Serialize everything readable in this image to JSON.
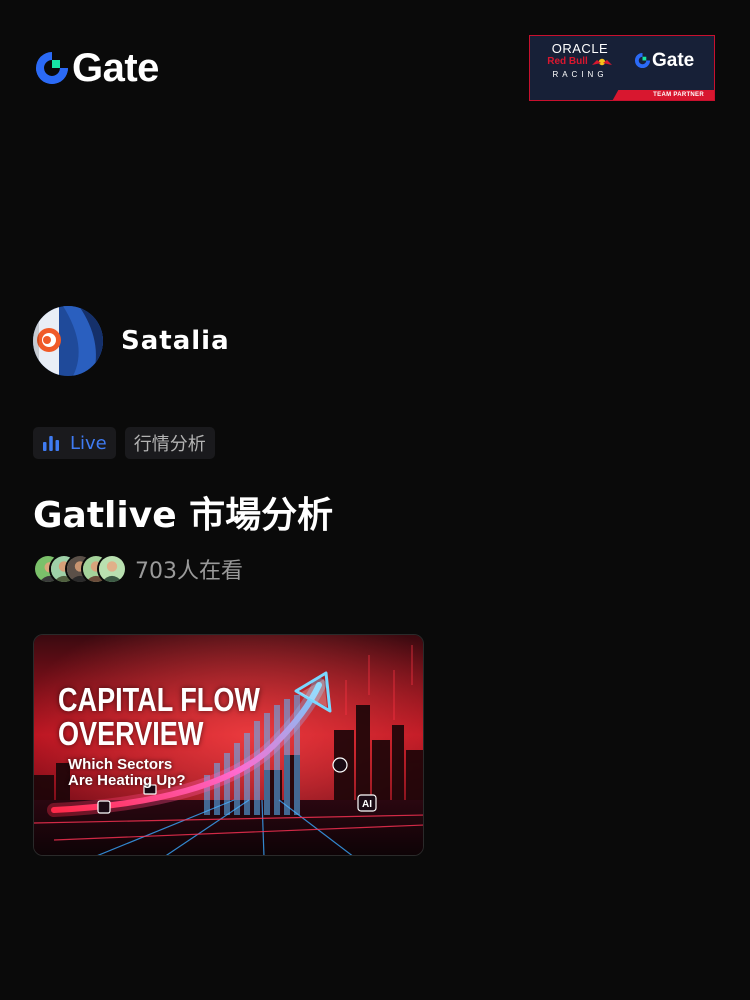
{
  "header": {
    "brand_name": "Gate",
    "brand_icon": "gate-logo-icon",
    "partner_badge": {
      "line1": "ORACLE",
      "line2": "Red Bull",
      "line3": "RACING",
      "brand_name": "Gate",
      "strip_text": "TEAM PARTNER"
    }
  },
  "host": {
    "name": "Satalia",
    "avatar_icon": "host-avatar"
  },
  "tags": {
    "live_label": "Live",
    "live_icon": "bar-chart-icon",
    "topic_label": "行情分析"
  },
  "stream": {
    "title": "Gatlive 市場分析",
    "viewer_count": "703人在看",
    "viewer_avatar_count": 5
  },
  "thumbnail": {
    "headline_line1": "CAPITAL FLOW",
    "headline_line2": "OVERVIEW",
    "sub_line1": "Which Sectors",
    "sub_line2": "Are Heating Up?",
    "badge_text": "AI"
  },
  "colors": {
    "background": "#0a0a0a",
    "accent_blue": "#3f7bf2",
    "gate_green": "#17e5a5",
    "red_bull_red": "#d8172f",
    "tag_bg": "#1a1a1d"
  }
}
